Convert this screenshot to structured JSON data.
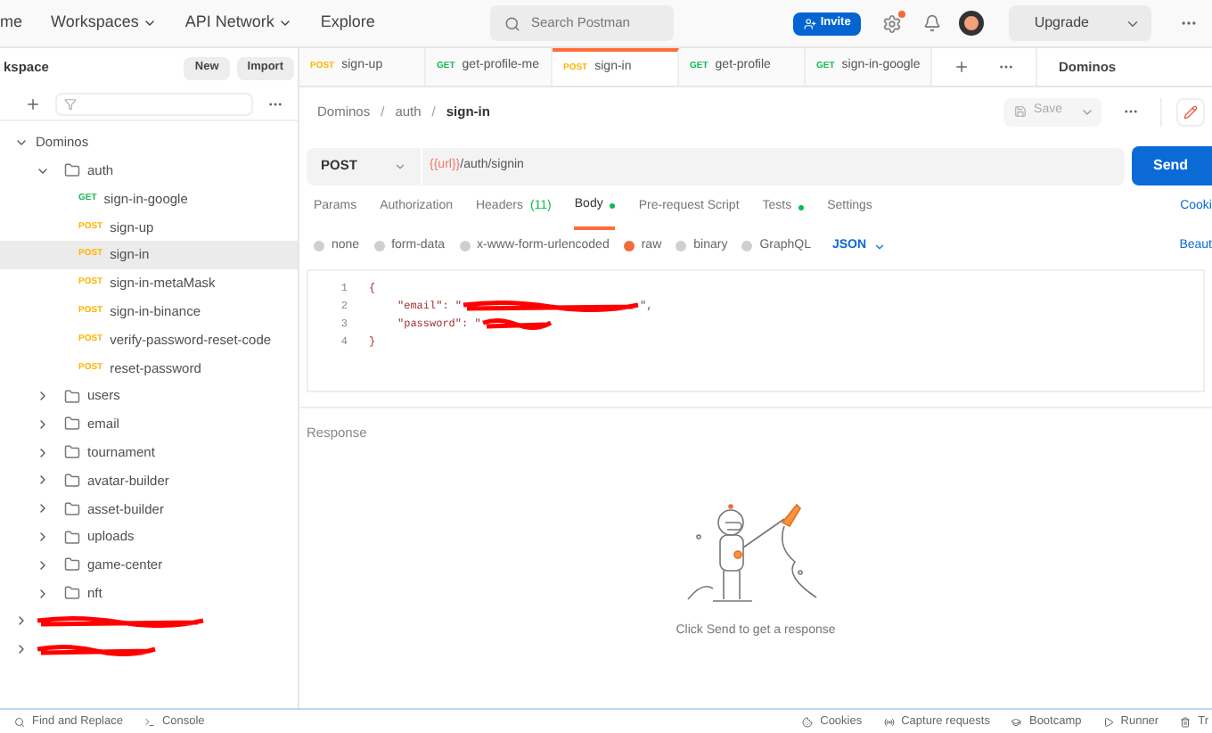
{
  "header": {
    "nav": [
      {
        "label": "me",
        "dropdown": false
      },
      {
        "label": "Workspaces",
        "dropdown": true
      },
      {
        "label": "API Network",
        "dropdown": true
      },
      {
        "label": "Explore",
        "dropdown": false
      }
    ],
    "search": {
      "placeholder": "Search Postman"
    },
    "invite": "Invite",
    "settings_badge": true,
    "upgrade": "Upgrade"
  },
  "sidebar": {
    "title": "kspace",
    "buttons": [
      "New",
      "Import"
    ],
    "tree": [
      {
        "kind": "collection",
        "label": "Dominos",
        "expanded": true,
        "children": [
          {
            "kind": "folder",
            "label": "auth",
            "expanded": true,
            "children": [
              {
                "kind": "request",
                "method": "GET",
                "color": "#0cbb52",
                "label": "sign-in-google",
                "selected": false
              },
              {
                "kind": "request",
                "method": "POST",
                "color": "#ffb400",
                "label": "sign-up",
                "selected": false
              },
              {
                "kind": "request",
                "method": "POST",
                "color": "#ffb400",
                "label": "sign-in",
                "selected": true
              },
              {
                "kind": "request",
                "method": "POST",
                "color": "#ffb400",
                "label": "sign-in-metaMask",
                "selected": false
              },
              {
                "kind": "request",
                "method": "POST",
                "color": "#ffb400",
                "label": "sign-in-binance",
                "selected": false
              },
              {
                "kind": "request",
                "method": "POST",
                "color": "#ffb400",
                "label": "verify-password-reset-code",
                "selected": false
              },
              {
                "kind": "request",
                "method": "POST",
                "color": "#ffb400",
                "label": "reset-password",
                "selected": false
              }
            ]
          },
          {
            "kind": "folder",
            "label": "users",
            "expanded": false
          },
          {
            "kind": "folder",
            "label": "email",
            "expanded": false
          },
          {
            "kind": "folder",
            "label": "tournament",
            "expanded": false
          },
          {
            "kind": "folder",
            "label": "avatar-builder",
            "expanded": false
          },
          {
            "kind": "folder",
            "label": "asset-builder",
            "expanded": false
          },
          {
            "kind": "folder",
            "label": "uploads",
            "expanded": false
          },
          {
            "kind": "folder",
            "label": "game-center",
            "expanded": false
          },
          {
            "kind": "folder",
            "label": "nft",
            "expanded": false
          }
        ]
      },
      {
        "kind": "redacted",
        "expanded": false
      },
      {
        "kind": "redacted",
        "expanded": false
      }
    ]
  },
  "tabs": [
    {
      "method": "POST",
      "color": "#ffb400",
      "label": "sign-up",
      "selected": false
    },
    {
      "method": "GET",
      "color": "#0cbb52",
      "label": "get-profile-me",
      "selected": false
    },
    {
      "method": "POST",
      "color": "#ffb400",
      "label": "sign-in",
      "selected": true
    },
    {
      "method": "GET",
      "color": "#0cbb52",
      "label": "get-profile",
      "selected": false
    },
    {
      "method": "GET",
      "color": "#0cbb52",
      "label": "sign-in-google",
      "selected": false
    }
  ],
  "environment": "Dominos",
  "breadcrumb": {
    "items": [
      "Dominos",
      "auth",
      "sign-in"
    ],
    "separators": [
      "/",
      "/"
    ]
  },
  "save": "Save",
  "request": {
    "method": "POST",
    "url_variable": "{{url}}",
    "url_path": "/auth/signin",
    "send": "Send"
  },
  "request_tabs": [
    {
      "label": "Params",
      "selected": false,
      "dot": false
    },
    {
      "label": "Authorization",
      "selected": false,
      "dot": false
    },
    {
      "label": "Headers",
      "count": "(11)",
      "selected": false,
      "dot": false
    },
    {
      "label": "Body",
      "selected": true,
      "dot": true
    },
    {
      "label": "Pre-request Script",
      "selected": false,
      "dot": false
    },
    {
      "label": "Tests",
      "selected": false,
      "dot": true
    },
    {
      "label": "Settings",
      "selected": false,
      "dot": false
    }
  ],
  "cookies_link": "Cooki",
  "body_types": [
    {
      "label": "none",
      "selected": false
    },
    {
      "label": "form-data",
      "selected": false
    },
    {
      "label": "x-www-form-urlencoded",
      "selected": false
    },
    {
      "label": "raw",
      "selected": true
    },
    {
      "label": "binary",
      "selected": false
    },
    {
      "label": "GraphQL",
      "selected": false
    }
  ],
  "format": "JSON",
  "beautify_link": "Beaut",
  "code": [
    {
      "number": "1",
      "text": "{"
    },
    {
      "number": "2",
      "text": "\"email\": \"",
      "redacted": true,
      "tail": "\","
    },
    {
      "number": "3",
      "text": "\"password\": \"",
      "redacted": true
    },
    {
      "number": "4",
      "text": "}"
    }
  ],
  "response": {
    "title": "Response",
    "message": "Click Send to get a response"
  },
  "status_bar": {
    "left": [
      "Find and Replace",
      "Console"
    ],
    "right": [
      "Cookies",
      "Capture requests",
      "Bootcamp",
      "Runner",
      "Tr"
    ]
  }
}
